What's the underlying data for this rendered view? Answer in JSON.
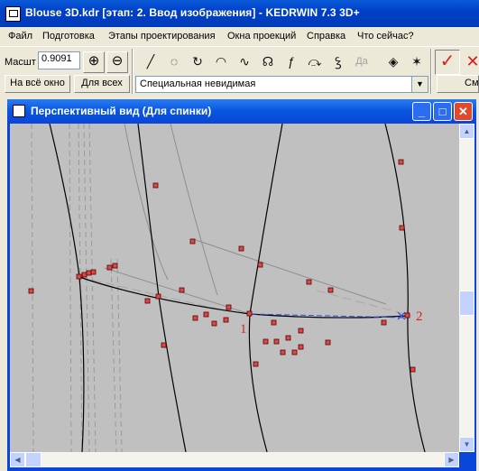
{
  "window": {
    "title": "Blouse 3D.kdr [этап: 2. Ввод изображения] - KEDRWIN 7.3 3D+"
  },
  "menu": [
    "Файл",
    "Подготовка",
    "Этапы проектирования",
    "Окна проекций",
    "Справка",
    "Что сейчас?"
  ],
  "toolbar": {
    "scale_label": "Масшт",
    "scale_value": "0.9091",
    "fit_window_label": "На всё окно",
    "fit_all_label": "Для всех",
    "line_type_value": "Специальная невидимая",
    "yes_label": "Да",
    "right_label": "Сме"
  },
  "child": {
    "title": "Перспективный вид (Для спинки)"
  },
  "canvas": {
    "labels": [
      "1",
      "2"
    ],
    "accent": "#D82020",
    "point_color": "#E04848"
  }
}
